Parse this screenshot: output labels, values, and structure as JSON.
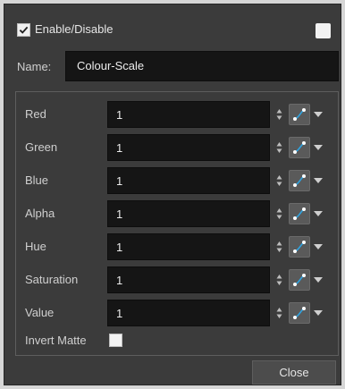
{
  "enable": {
    "label": "Enable/Disable",
    "checked": true
  },
  "name": {
    "label": "Name:",
    "value": "Colour-Scale"
  },
  "rows": [
    {
      "label": "Red",
      "value": "1"
    },
    {
      "label": "Green",
      "value": "1"
    },
    {
      "label": "Blue",
      "value": "1"
    },
    {
      "label": "Alpha",
      "value": "1"
    },
    {
      "label": "Hue",
      "value": "1"
    },
    {
      "label": "Saturation",
      "value": "1"
    },
    {
      "label": "Value",
      "value": "1"
    }
  ],
  "invert_matte": {
    "label": "Invert Matte",
    "checked": false
  },
  "close_label": "Close",
  "icons": {
    "enable_check": "checkmark-icon",
    "spin": "spin-arrows-icon",
    "function": "function-curve-icon",
    "dropdown": "chevron-down-icon"
  },
  "colors": {
    "dialog_bg": "#3b3b3b",
    "field_bg": "#151515",
    "accent": "#1e9bdc"
  }
}
